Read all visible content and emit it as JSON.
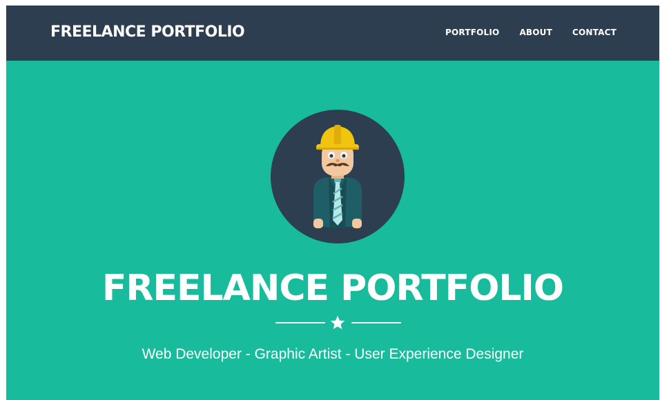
{
  "navbar": {
    "brand": "FREELANCE PORTFOLIO",
    "links": [
      "PORTFOLIO",
      "ABOUT",
      "CONTACT"
    ]
  },
  "hero": {
    "avatar_icon": "construction-worker-avatar-icon",
    "title": "FREELANCE PORTFOLIO",
    "divider_icon": "star-icon",
    "subtitle": "Web Developer - Graphic Artist - User Experience Designer"
  },
  "colors": {
    "navbar_bg": "#2C3E50",
    "hero_bg": "#18BC9C",
    "text": "#FFFFFF"
  }
}
